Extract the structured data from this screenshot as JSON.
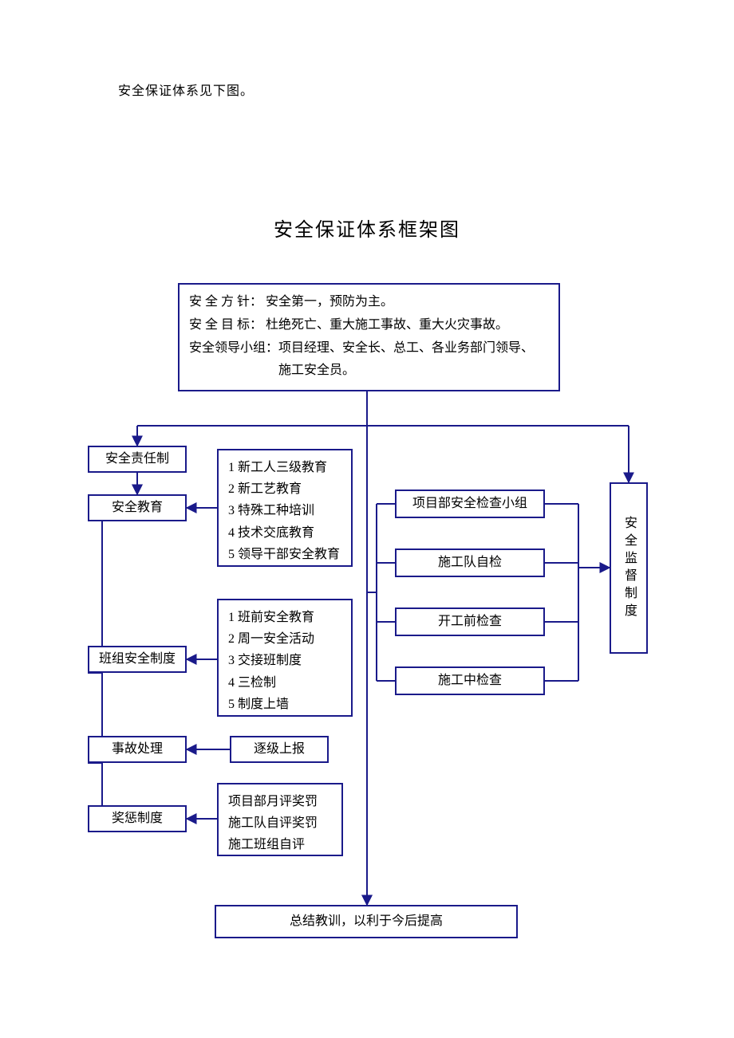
{
  "intro": "安全保证体系见下图。",
  "title": "安全保证体系框架图",
  "header": {
    "policy_label": "安 全 方 针：",
    "policy_value": " 安全第一，预防为主。",
    "target_label": "安 全 目 标：",
    "target_value": " 杜绝死亡、重大施工事故、重大火灾事故。",
    "group_label": "安全领导小组：",
    "group_value_1": "项目经理、安全长、总工、各业务部门领导、",
    "group_value_2": "施工安全员。"
  },
  "left_chain": {
    "b1": "安全责任制",
    "b2": "安全教育",
    "b3": "班组安全制度",
    "b4": "事故处理",
    "b5": "奖惩制度"
  },
  "edu_details": {
    "l1": "1 新工人三级教育",
    "l2": "2 新工艺教育",
    "l3": "3 特殊工种培训",
    "l4": "4 技术交底教育",
    "l5": "5 领导干部安全教育"
  },
  "team_details": {
    "l1": "1 班前安全教育",
    "l2": "2 周一安全活动",
    "l3": "3 交接班制度",
    "l4": "4 三检制",
    "l5": "5 制度上墙"
  },
  "incident_detail": "逐级上报",
  "reward_details": {
    "l1": "项目部月评奖罚",
    "l2": "施工队自评奖罚",
    "l3": "施工班组自评"
  },
  "right_boxes": {
    "r1": "项目部安全检查小组",
    "r2": "施工队自检",
    "r3": "开工前检查",
    "r4": "施工中检查"
  },
  "vertical_right": "安全监督制度",
  "bottom": "总结教训，以利于今后提高"
}
